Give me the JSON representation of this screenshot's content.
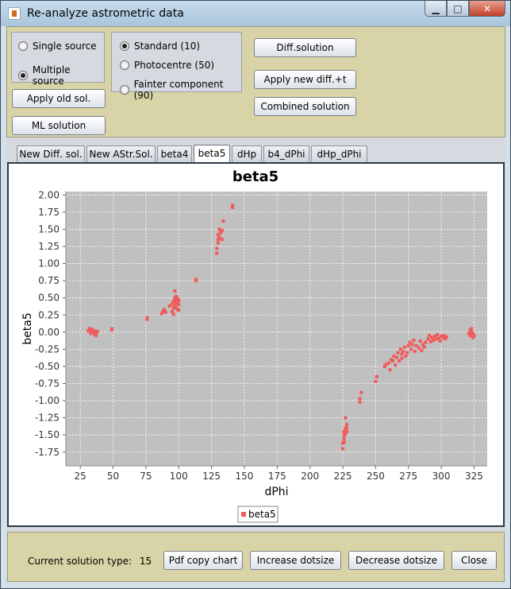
{
  "window": {
    "title": "Re-analyze astrometric data",
    "controls": {
      "minimize": "▁",
      "maximize": "□",
      "close": "✕"
    }
  },
  "source_group": {
    "options": [
      {
        "label": "Single source",
        "selected": false
      },
      {
        "label": "Multiple source",
        "selected": true
      }
    ]
  },
  "component_group": {
    "options": [
      {
        "label": "Standard (10)",
        "selected": true
      },
      {
        "label": "Photocentre (50)",
        "selected": false
      },
      {
        "label": "Fainter component (90)",
        "selected": false
      }
    ]
  },
  "buttons": {
    "apply_old": "Apply old sol.",
    "ml_solution": "ML solution",
    "diff_solution": "Diff.solution",
    "apply_new_diff": "Apply new diff.+t",
    "combined_solution": "Combined solution",
    "pdf_copy": "Pdf copy chart",
    "increase_dotsize": "Increase dotsize",
    "decrease_dotsize": "Decrease dotsize",
    "close": "Close"
  },
  "tabs": [
    {
      "label": "New Diff. sol.",
      "active": false
    },
    {
      "label": "New AStr.Sol.",
      "active": false
    },
    {
      "label": "beta4",
      "active": false
    },
    {
      "label": "beta5",
      "active": true
    },
    {
      "label": "dHp",
      "active": false
    },
    {
      "label": "b4_dPhi",
      "active": false
    },
    {
      "label": "dHp_dPhi",
      "active": false
    }
  ],
  "status": {
    "label": "Current solution type:",
    "value": "15"
  },
  "colors": {
    "series": "#f05a5a",
    "plot_background": "#c0c0c0",
    "top_panel": "#d8d4a8"
  },
  "chart_data": {
    "type": "scatter",
    "title": "beta5",
    "xlabel": "dPhi",
    "ylabel": "beta5",
    "xlim": [
      14,
      335
    ],
    "ylim": [
      -1.95,
      2.05
    ],
    "xticks": [
      25,
      50,
      75,
      100,
      125,
      150,
      175,
      200,
      225,
      250,
      275,
      300,
      325
    ],
    "yticks": [
      2.0,
      1.75,
      1.5,
      1.25,
      1.0,
      0.75,
      0.5,
      0.25,
      0.0,
      -0.25,
      -0.5,
      -0.75,
      -1.0,
      -1.25,
      -1.5,
      -1.75
    ],
    "xtick_labels": [
      "25",
      "50",
      "75",
      "100",
      "125",
      "150",
      "175",
      "200",
      "225",
      "250",
      "275",
      "300",
      "325"
    ],
    "ytick_labels": [
      "2.00",
      "1.75",
      "1.50",
      "1.25",
      "1.00",
      "0.75",
      "0.50",
      "0.25",
      "0.00",
      "-0.25",
      "-0.50",
      "-0.75",
      "-1.00",
      "-1.25",
      "-1.50",
      "-1.75"
    ],
    "grid": true,
    "legend_position": "bottom-center",
    "series": [
      {
        "name": "beta5",
        "points": [
          [
            31,
            0.02
          ],
          [
            32,
            0.05
          ],
          [
            33,
            -0.02
          ],
          [
            33,
            0.01
          ],
          [
            34,
            0.04
          ],
          [
            35,
            0.0
          ],
          [
            36,
            -0.03
          ],
          [
            36,
            0.02
          ],
          [
            37,
            -0.05
          ],
          [
            37,
            0.0
          ],
          [
            38,
            0.01
          ],
          [
            49,
            0.03
          ],
          [
            49,
            0.05
          ],
          [
            76,
            0.21
          ],
          [
            76,
            0.19
          ],
          [
            87,
            0.27
          ],
          [
            88,
            0.3
          ],
          [
            89,
            0.33
          ],
          [
            90,
            0.29
          ],
          [
            93,
            0.38
          ],
          [
            95,
            0.3
          ],
          [
            95,
            0.41
          ],
          [
            96,
            0.35
          ],
          [
            96,
            0.45
          ],
          [
            96,
            0.26
          ],
          [
            97,
            0.43
          ],
          [
            97,
            0.38
          ],
          [
            97,
            0.5
          ],
          [
            97,
            0.6
          ],
          [
            98,
            0.36
          ],
          [
            98,
            0.47
          ],
          [
            98,
            0.52
          ],
          [
            99,
            0.33
          ],
          [
            99,
            0.42
          ],
          [
            99,
            0.49
          ],
          [
            100,
            0.4
          ],
          [
            100,
            0.46
          ],
          [
            100,
            0.32
          ],
          [
            113,
            0.77
          ],
          [
            113,
            0.75
          ],
          [
            129,
            1.15
          ],
          [
            129,
            1.22
          ],
          [
            130,
            1.3
          ],
          [
            130,
            1.35
          ],
          [
            130,
            1.42
          ],
          [
            131,
            1.38
          ],
          [
            131,
            1.5
          ],
          [
            132,
            1.45
          ],
          [
            133,
            1.35
          ],
          [
            133,
            1.48
          ],
          [
            134,
            1.62
          ],
          [
            141,
            1.82
          ],
          [
            141,
            1.85
          ],
          [
            225,
            -1.7
          ],
          [
            225,
            -1.62
          ],
          [
            226,
            -1.55
          ],
          [
            226,
            -1.5
          ],
          [
            226,
            -1.45
          ],
          [
            227,
            -1.48
          ],
          [
            227,
            -1.4
          ],
          [
            228,
            -1.35
          ],
          [
            228,
            -1.4
          ],
          [
            227,
            -1.25
          ],
          [
            226,
            -1.6
          ],
          [
            228,
            -1.45
          ],
          [
            238,
            -1.02
          ],
          [
            238,
            -0.97
          ],
          [
            239,
            -0.88
          ],
          [
            250,
            -0.72
          ],
          [
            251,
            -0.65
          ],
          [
            257,
            -0.5
          ],
          [
            258,
            -0.47
          ],
          [
            260,
            -0.45
          ],
          [
            261,
            -0.55
          ],
          [
            262,
            -0.4
          ],
          [
            263,
            -0.42
          ],
          [
            264,
            -0.35
          ],
          [
            265,
            -0.48
          ],
          [
            266,
            -0.37
          ],
          [
            267,
            -0.3
          ],
          [
            268,
            -0.42
          ],
          [
            269,
            -0.25
          ],
          [
            270,
            -0.32
          ],
          [
            270,
            -0.38
          ],
          [
            271,
            -0.28
          ],
          [
            272,
            -0.22
          ],
          [
            273,
            -0.35
          ],
          [
            274,
            -0.3
          ],
          [
            275,
            -0.2
          ],
          [
            276,
            -0.15
          ],
          [
            277,
            -0.25
          ],
          [
            278,
            -0.18
          ],
          [
            279,
            -0.12
          ],
          [
            280,
            -0.28
          ],
          [
            281,
            -0.2
          ],
          [
            283,
            -0.23
          ],
          [
            284,
            -0.13
          ],
          [
            285,
            -0.27
          ],
          [
            286,
            -0.18
          ],
          [
            287,
            -0.22
          ],
          [
            288,
            -0.15
          ],
          [
            290,
            -0.1
          ],
          [
            291,
            -0.05
          ],
          [
            292,
            -0.14
          ],
          [
            293,
            -0.08
          ],
          [
            294,
            -0.12
          ],
          [
            295,
            -0.06
          ],
          [
            296,
            -0.1
          ],
          [
            297,
            -0.04
          ],
          [
            298,
            -0.09
          ],
          [
            299,
            -0.13
          ],
          [
            300,
            -0.06
          ],
          [
            301,
            -0.08
          ],
          [
            302,
            -0.05
          ],
          [
            303,
            -0.1
          ],
          [
            304,
            -0.07
          ],
          [
            321,
            -0.02
          ],
          [
            322,
            0.03
          ],
          [
            322,
            -0.05
          ],
          [
            323,
            0.0
          ],
          [
            323,
            0.05
          ],
          [
            324,
            -0.08
          ],
          [
            324,
            -0.02
          ],
          [
            325,
            -0.05
          ]
        ]
      }
    ]
  }
}
